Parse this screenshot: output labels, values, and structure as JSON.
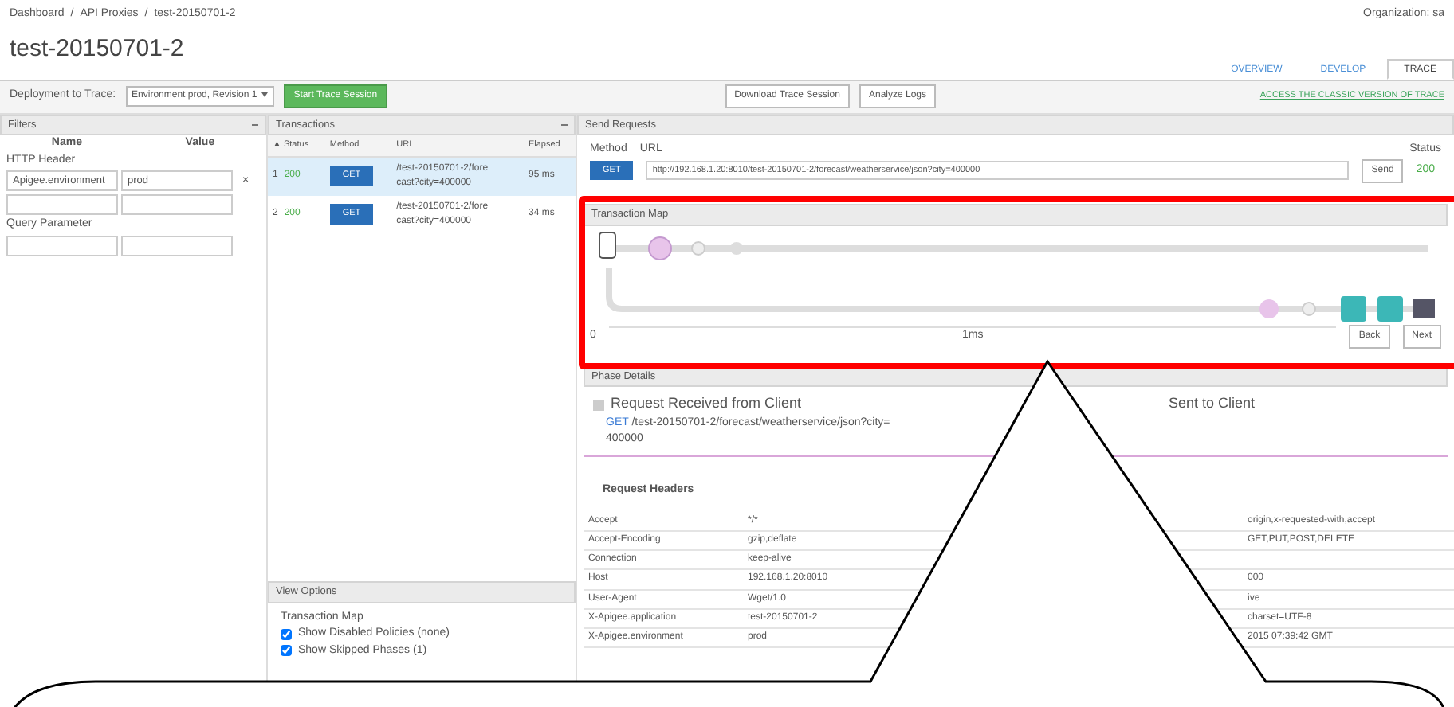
{
  "breadcrumb": [
    {
      "label": "Dashboard"
    },
    {
      "separator": "/",
      "label": "API Proxies"
    },
    {
      "separator": "/",
      "label": "test-20150701-2"
    }
  ],
  "organization": "Organization: sa",
  "title": "test-20150701-2",
  "tabs": [
    {
      "label": "OVERVIEW",
      "selected": false
    },
    {
      "label": "DEVELOP",
      "selected": false
    },
    {
      "label": "TRACE",
      "selected": true
    }
  ],
  "toolbar": {
    "deployment_label": "Deployment to Trace:",
    "deployment_value": "Environment prod, Revision 1",
    "start_button": "Start Trace Session",
    "download_button": "Download Trace Session",
    "logs_button": "Analyze Logs",
    "classic_link": "ACCESS THE CLASSIC VERSION OF TRACE"
  },
  "filters": {
    "title": "Filters",
    "columns": [
      "Name",
      "Value"
    ],
    "sections": [
      {
        "label": "HTTP Header",
        "rows": [
          {
            "kind": "filled",
            "name": "Apigee.environment",
            "value": "prod",
            "remove": "×"
          },
          {
            "kind": "blank"
          }
        ]
      },
      {
        "label": "Query Parameter",
        "rows": [
          {
            "kind": "blank"
          }
        ]
      }
    ]
  },
  "transactions": {
    "title": "Transactions",
    "columns": [
      "▲ Status",
      "Method",
      "URI",
      "Elapsed"
    ],
    "rows": [
      {
        "index": "1",
        "status": "200",
        "method": "GET",
        "uri": "/test-20150701-2/forecast?city=400000",
        "elapsed": "95 ms",
        "selected": true
      },
      {
        "index": "2",
        "status": "200",
        "method": "GET",
        "uri": "/test-20150701-2/forecast?city=400000",
        "elapsed": "34 ms",
        "selected": false
      }
    ]
  },
  "view_options": {
    "title": "View Options",
    "section": "Transaction Map",
    "options": [
      {
        "label": "Show Disabled Policies (none)",
        "checked": true
      },
      {
        "label": "Show Skipped Phases (1)",
        "checked": true
      }
    ]
  },
  "send_requests": {
    "title": "Send Requests",
    "method_label": "Method",
    "url_label": "URL",
    "method": "GET",
    "url": "http://192.168.1.20:8010/test-20150701-2/forecast/weatherservice/json?city=400000",
    "send_button": "Send",
    "status_label": "Status",
    "status": "200"
  },
  "transaction_map": {
    "title": "Transaction Map",
    "timeline_start": "0",
    "timeline_mark": "1ms",
    "back_button": "Back",
    "next_button": "Next"
  },
  "phase_details": {
    "title": "Phase Details",
    "phases": [
      {
        "title": "Request Received from Client",
        "method": "GET",
        "path": "/test-20150701-2/forecast/weatherservice/json?city=400000"
      },
      {
        "title": "Sent to Client"
      }
    ],
    "headers_title": "Request Headers",
    "request_headers": [
      {
        "name": "Accept",
        "value": "*/*",
        "response_value": "origin,x-requested-with,accept"
      },
      {
        "name": "Accept-Encoding",
        "value": "gzip,deflate",
        "response_value": "GET,PUT,POST,DELETE"
      },
      {
        "name": "Connection",
        "value": "keep-alive"
      },
      {
        "name": "Host",
        "value": "192.168.1.20:8010",
        "response_value": "000"
      },
      {
        "name": "User-Agent",
        "value": "Wget/1.0",
        "response_value": "ive"
      },
      {
        "name": "X-Apigee.application",
        "value": "test-20150701-2",
        "response_value": "charset=UTF-8"
      },
      {
        "name": "X-Apigee.environment",
        "value": "prod",
        "response_value": "2015 07:39:42 GMT"
      }
    ]
  }
}
